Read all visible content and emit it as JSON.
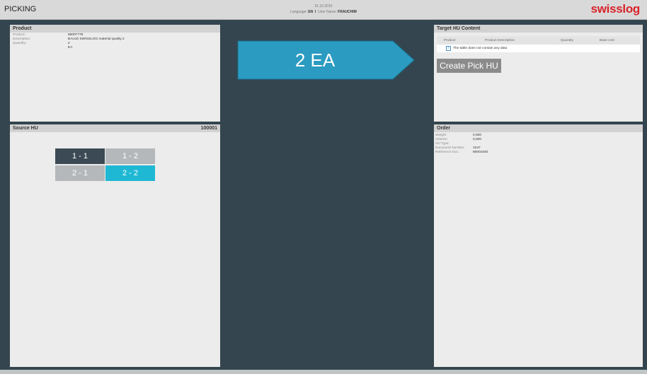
{
  "header": {
    "title": "PICKING",
    "date": "31.10.2016",
    "language_label": "Language:",
    "language_value": "EN",
    "separator": "I",
    "user_label": "User Name:",
    "user_value": "FRAUCHIM",
    "logo": "swisslog"
  },
  "product_panel": {
    "title": "Product",
    "rows": [
      {
        "label": "Product:",
        "value": "86007778"
      },
      {
        "label": "Description:",
        "value": "BAU10 SWISSLOG material quality 2"
      },
      {
        "label": "Quantity:",
        "value": "2"
      },
      {
        "label": "",
        "value": "EA"
      }
    ]
  },
  "quantity_display": {
    "text": "2 EA",
    "color": "#2b9bc1"
  },
  "source_hu": {
    "title": "Source HU",
    "id": "100001",
    "cells": [
      {
        "label": "1 - 1",
        "color": "#3b4a54"
      },
      {
        "label": "1 - 2",
        "color": "#b4b8bb"
      },
      {
        "label": "2 - 1",
        "color": "#b4b8bb"
      },
      {
        "label": "2 - 2",
        "color": "#1fb8d4"
      }
    ]
  },
  "target_hu": {
    "title": "Target HU Content",
    "columns": [
      "Product",
      "Product Description",
      "Quantity",
      "Base Unit"
    ],
    "empty_text": "The table does not contain any data",
    "create_button": "Create Pick HU"
  },
  "order_panel": {
    "title": "Order",
    "rows": [
      {
        "label": "Weight:",
        "value": "0,000"
      },
      {
        "label": "Volume:",
        "value": "0,000"
      },
      {
        "label": "HU Type:",
        "value": ""
      },
      {
        "label": "Document Number:",
        "value": "1047"
      },
      {
        "label": "Reference Doc.:",
        "value": "80001640"
      }
    ]
  }
}
